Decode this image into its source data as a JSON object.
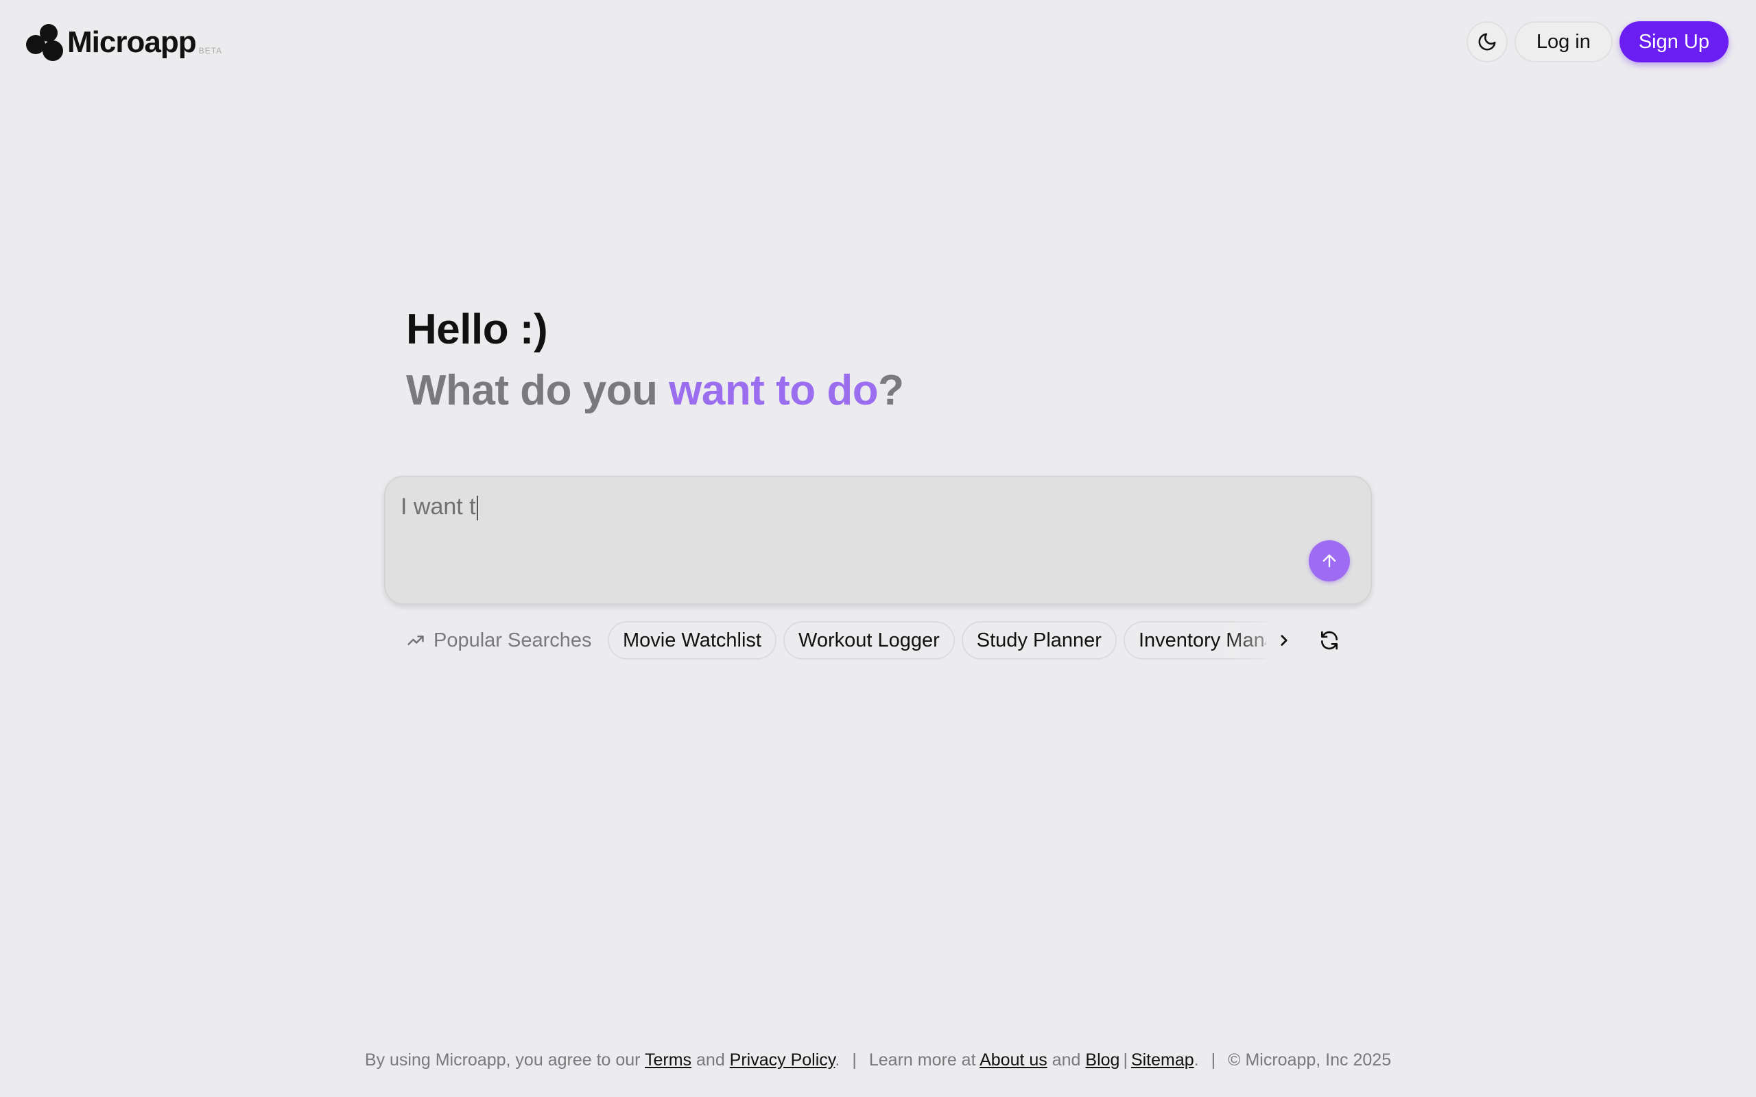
{
  "header": {
    "logo_text": "Microapp",
    "logo_badge": "BETA",
    "theme_icon": "moon-icon",
    "login_label": "Log in",
    "signup_label": "Sign Up"
  },
  "hero": {
    "greeting": "Hello :)",
    "question_prefix": "What do you ",
    "question_accent": "want to do",
    "question_suffix": "?"
  },
  "prompt": {
    "value": "I want t",
    "send_icon": "arrow-up-icon"
  },
  "popular": {
    "label": "Popular Searches",
    "label_icon": "trending-up-icon",
    "chips": [
      "Movie Watchlist",
      "Workout Logger",
      "Study Planner",
      "Inventory Mana"
    ],
    "next_icon": "chevron-right-icon",
    "refresh_icon": "refresh-icon"
  },
  "footer": {
    "prefix": "By using Microapp, you agree to our ",
    "terms": "Terms",
    "and1": " and ",
    "privacy": "Privacy Policy",
    "period1": ".",
    "sep1": "|",
    "learn": "Learn more at ",
    "about": "About us",
    "and2": " and ",
    "blog": "Blog",
    "bar": "|",
    "sitemap": "Sitemap",
    "period2": ".",
    "sep2": "|",
    "copyright": "© Microapp, Inc 2025"
  },
  "colors": {
    "accent": "#6a1ef2",
    "accent_light": "#9b6ef0",
    "background": "#ececee"
  }
}
